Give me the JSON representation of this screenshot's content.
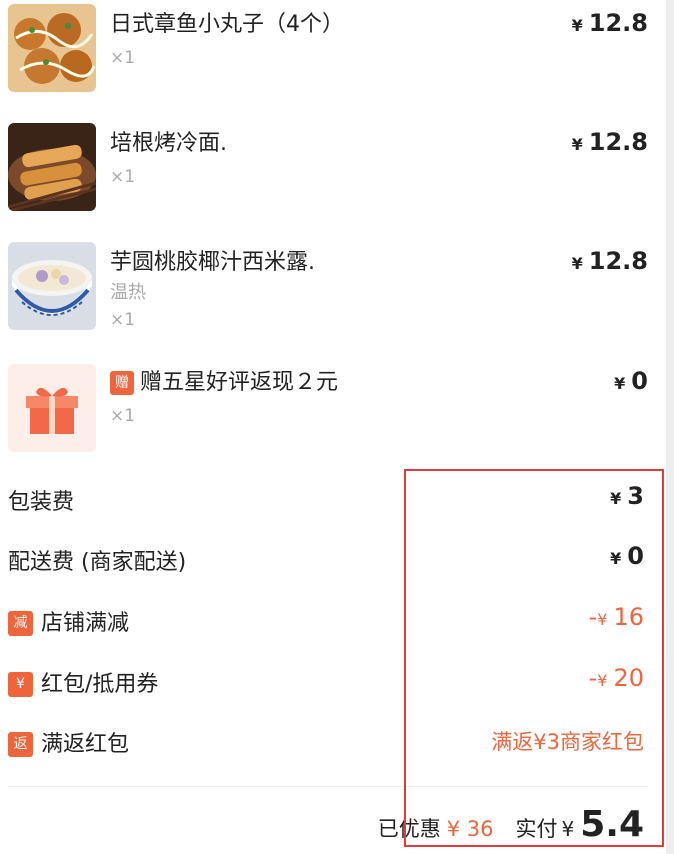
{
  "items": [
    {
      "name": "日式章鱼小丸子（4个）",
      "qty": "×1",
      "price": "12.8",
      "image_icon": "takoyaki-food-icon"
    },
    {
      "name": "培根烤冷面.",
      "qty": "×1",
      "price": "12.8",
      "image_icon": "bacon-cold-noodle-food-icon"
    },
    {
      "name": "芋圆桃胶椰汁西米露.",
      "spec": "温热",
      "qty": "×1",
      "price": "12.8",
      "image_icon": "taro-dessert-bowl-icon"
    }
  ],
  "gift": {
    "badge": "赠",
    "name": "赠五星好评返现２元",
    "qty": "×1",
    "price": "0",
    "image_icon": "gift-box-icon"
  },
  "currency": "¥",
  "fees": {
    "packaging": {
      "label": "包装费",
      "value": "3"
    },
    "delivery": {
      "label": "配送费 (商家配送)",
      "value": "0"
    },
    "store_discount": {
      "tag": "减",
      "label": "店铺满减",
      "prefix": "-",
      "value": "16"
    },
    "coupon": {
      "tag": "¥",
      "label": "红包/抵用券",
      "prefix": "-",
      "value": "20"
    },
    "cashback": {
      "tag": "返",
      "label": "满返红包",
      "value": "满返¥3商家红包"
    }
  },
  "summary": {
    "discount_label": "已优惠",
    "discount_value": "¥ 36",
    "paid_label": "实付",
    "paid_value": "5.4"
  },
  "colors": {
    "accent": "#f0643c",
    "highlight_box": "#e53a3a"
  }
}
